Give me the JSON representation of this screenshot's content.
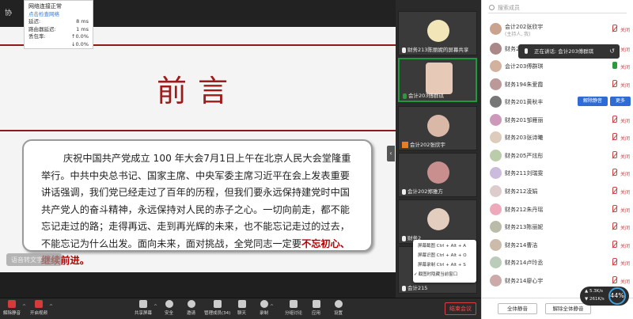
{
  "topbar": {
    "title_left": "协"
  },
  "network": {
    "title": "网络连接正常",
    "link": "点击检查网络",
    "rows": [
      {
        "label": "延迟:",
        "value": "8 ms"
      },
      {
        "label": "路由器延迟:",
        "value": "1 ms"
      },
      {
        "label": "丢包率:",
        "value": "↑0.0%"
      },
      {
        "label": "",
        "value": "↓0.0%"
      }
    ]
  },
  "slide": {
    "heading": "前言",
    "body_plain": "庆祝中国共产党成立 100 年大会7月1日上午在北京人民大会堂隆重举行。中共中央总书记、国家主席、中央军委主席习近平在会上发表重要讲话强调，我们党已经走过了百年的历程，但我们要永远保持建党时中国共产党人的奋斗精神，永远保持对人民的赤子之心。一切向前走，都不能忘记走过的路；走得再远、走到再光辉的未来，也不能忘记走过的过去，不能忘记为什么出发。面向未来，面对挑战，全党同志一定要",
    "body_highlight": "不忘初心、继续前进。",
    "subtitle_pill": "语音转文字",
    "arrow": "‹"
  },
  "videos": [
    {
      "label": "财务213陈丽妮的屏幕共享",
      "avatar_color": "#f2e6b8"
    },
    {
      "label": "会计203傅群琪",
      "avatar_color": "#e7c9b7"
    },
    {
      "label": "会计202张欣宇",
      "avatar_color": "#d9b8a8"
    },
    {
      "label": "会计202郑雅方",
      "avatar_color": "#c98f8f"
    },
    {
      "label": "财务2",
      "avatar_color": "#e3cdbf"
    },
    {
      "label": "会计215",
      "avatar_color": "#bbb"
    }
  ],
  "context_menu": [
    "屏幕截图 Ctrl + Alt + A",
    "屏幕识图 Ctrl + Alt + O",
    "屏幕录制 Ctrl + Alt + S",
    "截图时隐藏当前窗口"
  ],
  "panel": {
    "search_placeholder": "搜索成员",
    "speaking": "正在讲话: 会计203傅群琪",
    "members": [
      {
        "name": "会计202张欣宇",
        "sub": "(主持人, 我)",
        "color": "#c9a38d",
        "mic": "off"
      },
      {
        "name": "财务2",
        "sub": "",
        "color": "#a88",
        "mic": "off"
      },
      {
        "name": "会计203傅群琪",
        "sub": "",
        "color": "#d2b29e",
        "mic": "on"
      },
      {
        "name": "财务194朱爱霞",
        "sub": "",
        "color": "#b99",
        "mic": "off"
      },
      {
        "name": "财务201黄秋丰",
        "sub": "",
        "color": "#777",
        "mic": "none"
      },
      {
        "name": "财务201邹雁丽",
        "sub": "",
        "color": "#c9b",
        "mic": "off"
      },
      {
        "name": "财务203张诗曦",
        "sub": "",
        "color": "#dcb",
        "mic": "off"
      },
      {
        "name": "财务205严炫彤",
        "sub": "",
        "color": "#bca",
        "mic": "off"
      },
      {
        "name": "财务211刘瑞雯",
        "sub": "",
        "color": "#cbd",
        "mic": "off"
      },
      {
        "name": "财务212凌娟",
        "sub": "",
        "color": "#dcc",
        "mic": "off"
      },
      {
        "name": "财务212朱丹瑶",
        "sub": "",
        "color": "#eab",
        "mic": "off"
      },
      {
        "name": "财务213陈丽妮",
        "sub": "",
        "color": "#bba",
        "mic": "off"
      },
      {
        "name": "财务214曹洁",
        "sub": "",
        "color": "#cba",
        "mic": "off"
      },
      {
        "name": "财务214卢玲丞",
        "sub": "",
        "color": "#bcb",
        "mic": "off"
      },
      {
        "name": "财务214廖心宇",
        "sub": "",
        "color": "#caa",
        "mic": "off"
      }
    ],
    "unmute_label": "解除静音",
    "more_label": "更多",
    "video_label": "关闭",
    "mute_all": "全体静音",
    "unmute_all": "解除全体静音"
  },
  "speed": {
    "up": "▲ 5.3K/s",
    "down": "▼ 261K/s",
    "pct": "44%"
  },
  "toolbar": {
    "mute": "解除静音",
    "video": "开启视频",
    "share": "共享屏幕",
    "security": "安全",
    "invite": "邀请",
    "members": "管理成员(34)",
    "chat": "聊天",
    "record": "录制",
    "breakout": "分组讨论",
    "apps": "应用",
    "settings": "设置",
    "end": "结束会议"
  }
}
